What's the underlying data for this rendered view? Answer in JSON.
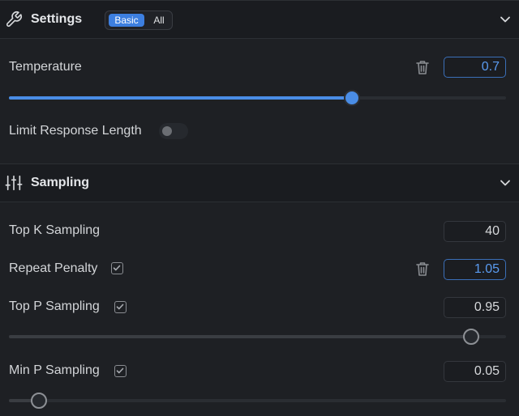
{
  "settings": {
    "title": "Settings",
    "mode_basic": "Basic",
    "mode_all": "All",
    "temperature": {
      "label": "Temperature",
      "value": "0.7",
      "slider_fraction": 0.69
    },
    "limit_length": {
      "label": "Limit Response Length",
      "enabled": false
    }
  },
  "sampling": {
    "title": "Sampling",
    "top_k": {
      "label": "Top K Sampling",
      "value": "40"
    },
    "repeat_penalty": {
      "label": "Repeat Penalty",
      "value": "1.05",
      "checked": true
    },
    "top_p": {
      "label": "Top P Sampling",
      "value": "0.95",
      "checked": true,
      "slider_fraction": 0.93
    },
    "min_p": {
      "label": "Min P Sampling",
      "value": "0.05",
      "checked": true,
      "slider_fraction": 0.06
    }
  },
  "colors": {
    "accent": "#4a8de6",
    "background": "#1e2024"
  }
}
